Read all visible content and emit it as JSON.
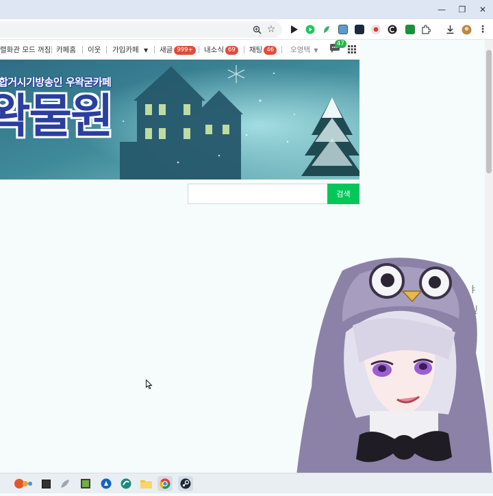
{
  "browser": {
    "window_controls": {
      "minimize": "—",
      "restore": "❐",
      "close": "✕"
    },
    "toolbar_icons": [
      "zoom-icon",
      "bookmark-star-icon",
      "play-icon",
      "extensions-icon",
      "download-icon",
      "profile-avatar",
      "more-menu-icon"
    ]
  },
  "cafe_nav": {
    "items": [
      {
        "label": "렬화관 모드 꺼짐"
      },
      {
        "label": "카페홈"
      },
      {
        "label": "이웃"
      },
      {
        "label": "가입카페"
      },
      {
        "label": "새글",
        "badge": "999+"
      },
      {
        "label": "내소식",
        "badge": "69"
      },
      {
        "label": "채팅",
        "badge": "46"
      },
      {
        "label": "오영택"
      }
    ],
    "chat_count": "47"
  },
  "banner": {
    "small_text": "합거시기방송인 우왁굳카페",
    "big_text": "왁물원"
  },
  "search": {
    "placeholder": "",
    "button_label": "검색"
  },
  "overlay": {
    "text_lines": [
      "ㅑㅑ",
      "싶"
    ]
  },
  "colors": {
    "accent_green": "#03c75a",
    "badge_red": "#e14b3b",
    "banner_blue": "#2a3f9e"
  }
}
